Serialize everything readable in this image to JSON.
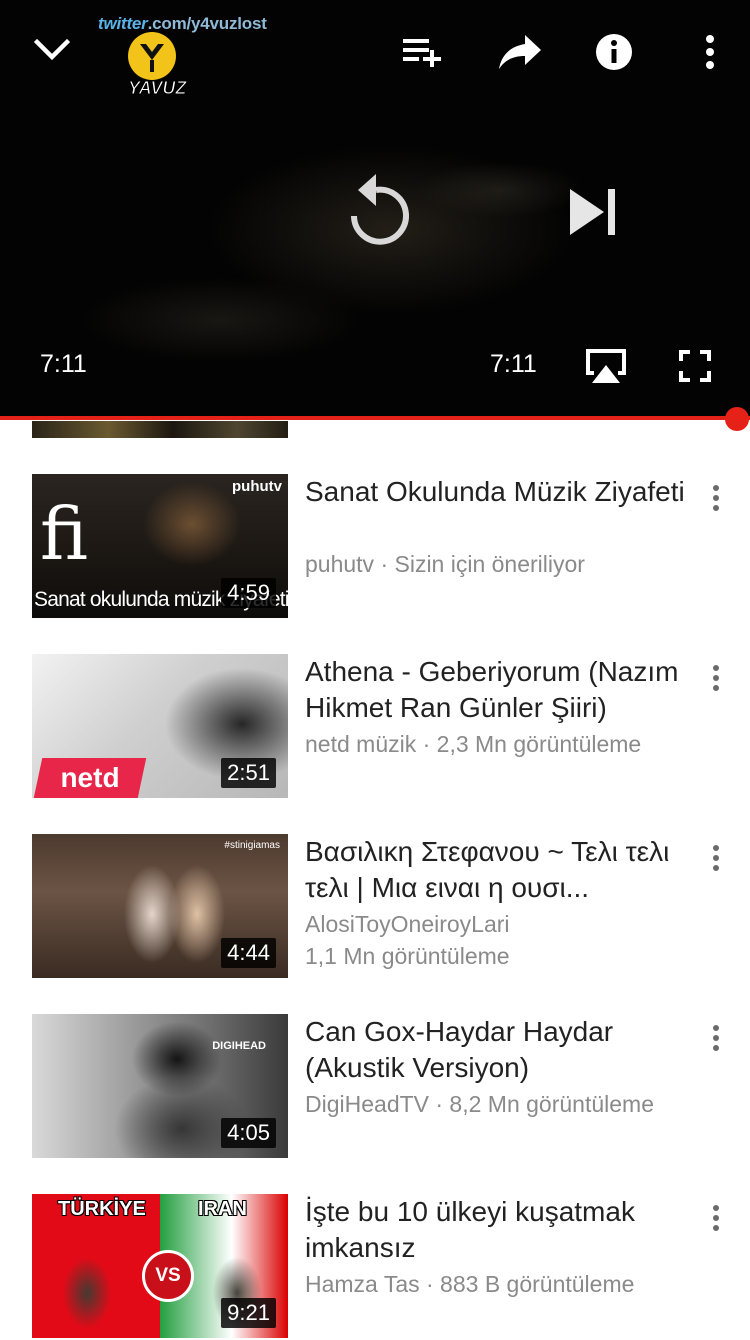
{
  "player": {
    "watermark_handle": "twitter.com/y4vuzlost",
    "watermark_twitter": "twitter",
    "watermark_url": ".com/y4vuzlost",
    "watermark_logo": "YAVUZ",
    "current_time": "7:11",
    "total_time": "7:11",
    "progress_fraction": 1.0,
    "icons": {
      "collapse": "chevron-down-icon",
      "add_to_playlist": "playlist-add-icon",
      "share": "share-icon",
      "info": "info-icon",
      "more": "more-vertical-icon",
      "replay": "replay-icon",
      "next": "skip-next-icon",
      "airplay": "airplay-icon",
      "fullscreen": "fullscreen-icon"
    },
    "accent_color": "#e62117"
  },
  "videos": [
    {
      "title": "Sanat Okulunda Müzik Ziyafeti",
      "meta": "puhutv · Sizin için öneriliyor",
      "duration": "4:59",
      "thumb_text": {
        "channel_logo": "puhutv",
        "initials": "fi",
        "caption": "Sanat okulunda müzik ziyafeti"
      }
    },
    {
      "title": "Athena - Geberiyorum (Nazım Hikmet Ran Günler Şiiri)",
      "meta": "netd müzik · 2,3 Mn görüntüleme",
      "duration": "2:51",
      "thumb_text": {
        "logo": "netd"
      }
    },
    {
      "title": "Βασιλικη Στεφανου ~ Τελι τελι τελι | Μια ειναι η ουσι...",
      "meta": "AlosiToyOneiroyLari",
      "meta_line2": "1,1 Mn görüntüleme",
      "duration": "4:44",
      "thumb_text": {
        "tag": "#stinigiamas"
      }
    },
    {
      "title": "Can Gox-Haydar Haydar (Akustik Versiyon)",
      "meta": "DigiHeadTV · 8,2 Mn görüntüleme",
      "duration": "4:05",
      "thumb_text": {
        "logo": "DIGIHEAD"
      }
    },
    {
      "title": "İşte bu 10 ülkeyi kuşatmak imkansız",
      "meta": "Hamza Tas · 883 B görüntüleme",
      "duration": "9:21",
      "thumb_text": {
        "left": "TÜRKİYE",
        "right": "IRAN",
        "vs": "VS"
      }
    }
  ]
}
